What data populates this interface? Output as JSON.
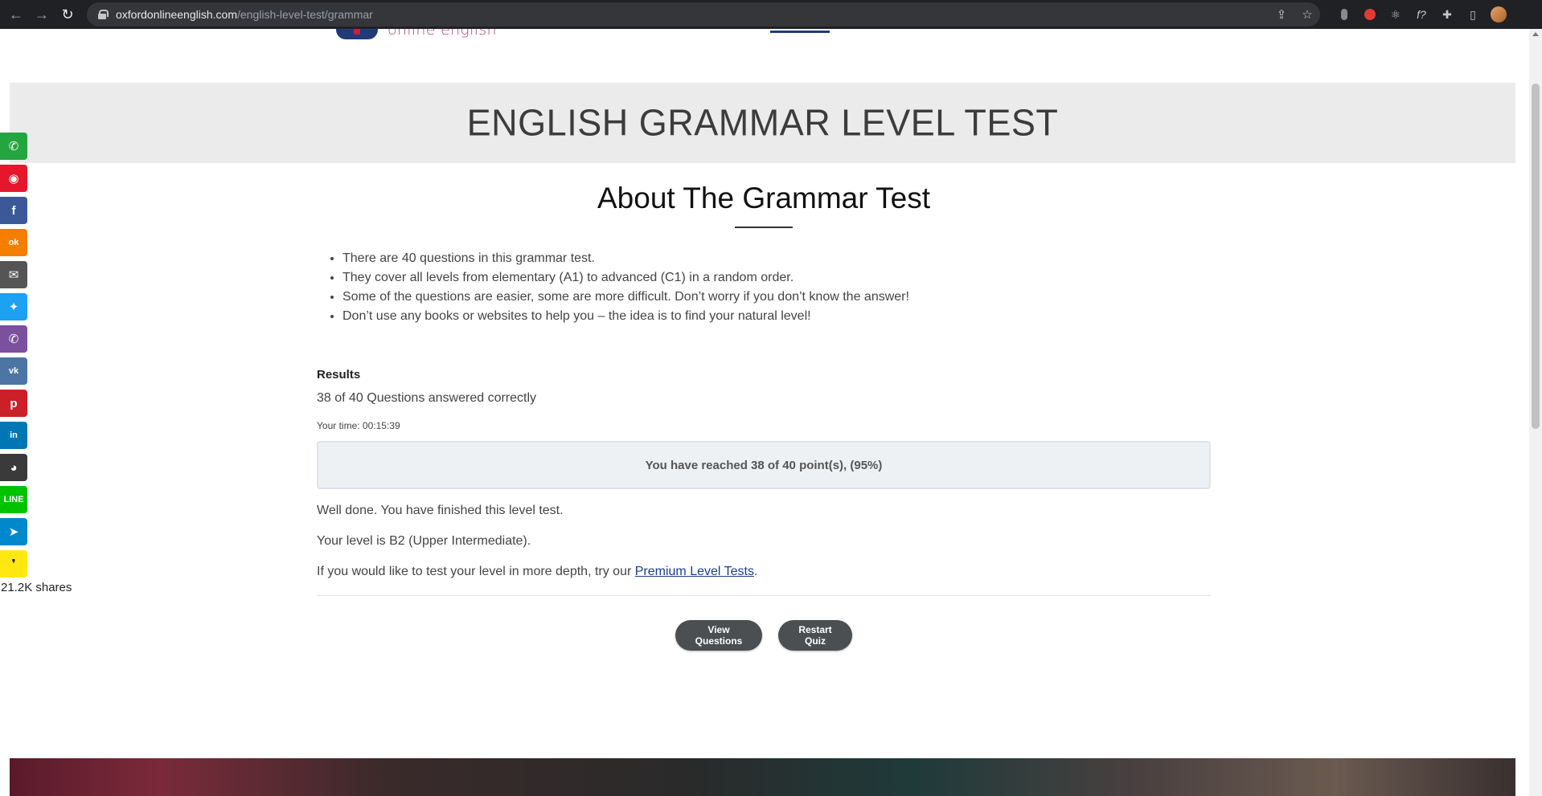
{
  "browser": {
    "url_host": "oxfordonlineenglish.com",
    "url_path": "/english-level-test/grammar",
    "back": "←",
    "forward": "→",
    "reload": "↻",
    "share_icon": "⇪",
    "star_icon": "☆",
    "ext_atom": "⚛",
    "ext_f": "f?",
    "ext_puzzle": "✚",
    "ext_sidepanel": "▯"
  },
  "site": {
    "logo_text": "online english"
  },
  "banner": {
    "title": "ENGLISH GRAMMAR LEVEL TEST"
  },
  "about": {
    "title": "About The Grammar Test",
    "rules": [
      "There are 40 questions in this grammar test.",
      "They cover all levels from elementary (A1) to advanced (C1) in a random order.",
      "Some of the questions are easier, some are more difficult. Don’t worry if you don’t know the answer!",
      "Don’t use any books or websites to help you – the idea is to find your natural level!"
    ]
  },
  "results": {
    "heading": "Results",
    "score_line": "38 of 40 Questions answered correctly",
    "time_line": "Your time: 00:15:39",
    "points_line": "You have reached 38 of 40 point(s), (95%)",
    "message1": "Well done. You have finished this level test.",
    "message2": "Your level is B2 (Upper Intermediate).",
    "message3_prefix": "If you would like to test your level in more depth, try our ",
    "message3_link": "Premium Level Tests",
    "message3_suffix": ".",
    "view_questions": "View Questions",
    "restart_quiz": "Restart Quiz"
  },
  "social": {
    "shares": "21.2K shares",
    "buttons": [
      {
        "name": "whatsapp",
        "glyph": "✆",
        "color": "#25a53f"
      },
      {
        "name": "weibo",
        "glyph": "◉",
        "color": "#e6162d"
      },
      {
        "name": "facebook",
        "glyph": "f",
        "color": "#3b5998"
      },
      {
        "name": "odnoklassniki",
        "glyph": "ok",
        "color": "#f57d00"
      },
      {
        "name": "email",
        "glyph": "✉",
        "color": "#555555"
      },
      {
        "name": "twitter",
        "glyph": "✦",
        "color": "#1da1f2"
      },
      {
        "name": "viber",
        "glyph": "✆",
        "color": "#7b519d"
      },
      {
        "name": "vk",
        "glyph": "vk",
        "color": "#4c75a3"
      },
      {
        "name": "pinterest",
        "glyph": "p",
        "color": "#cb2027"
      },
      {
        "name": "linkedin",
        "glyph": "in",
        "color": "#0077b5"
      },
      {
        "name": "reddit",
        "glyph": "◕",
        "color": "#3a3a3a"
      },
      {
        "name": "line",
        "glyph": "LINE",
        "color": "#00c300"
      },
      {
        "name": "telegram",
        "glyph": "➤",
        "color": "#0088cc"
      },
      {
        "name": "kakao",
        "glyph": "❜",
        "color": "#ffe812"
      }
    ]
  }
}
